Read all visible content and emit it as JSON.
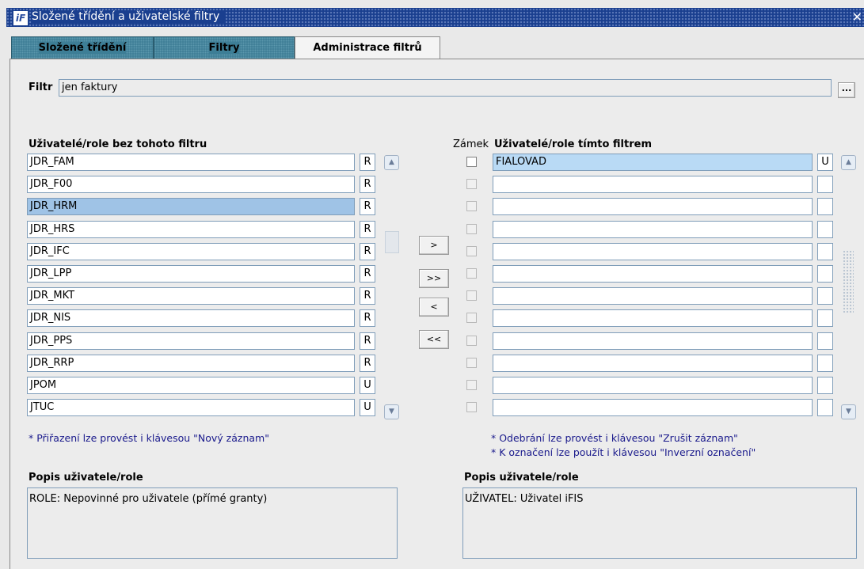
{
  "window": {
    "title": "Složené třídění a uživatelské filtry",
    "icon": "oracle-forms-icon"
  },
  "tabs": [
    {
      "label": "Složené třídění",
      "active": false
    },
    {
      "label": "Filtry",
      "active": false
    },
    {
      "label": "Administrace filtrů",
      "active": true
    }
  ],
  "filter": {
    "label": "Filtr",
    "value": "jen faktury",
    "lookup_label": "..."
  },
  "left_list": {
    "header": "Uživatelé/role bez tohoto filtru",
    "rows": [
      {
        "name": "JDR_FAM",
        "type": "R"
      },
      {
        "name": "JDR_F00",
        "type": "R"
      },
      {
        "name": "JDR_HRM",
        "type": "R"
      },
      {
        "name": "JDR_HRS",
        "type": "R"
      },
      {
        "name": "JDR_IFC",
        "type": "R"
      },
      {
        "name": "JDR_LPP",
        "type": "R"
      },
      {
        "name": "JDR_MKT",
        "type": "R"
      },
      {
        "name": "JDR_NIS",
        "type": "R"
      },
      {
        "name": "JDR_PPS",
        "type": "R"
      },
      {
        "name": "JDR_RRP",
        "type": "R"
      },
      {
        "name": "JPOM",
        "type": "U"
      },
      {
        "name": "JTUC",
        "type": "U"
      }
    ],
    "selected_index": 2,
    "note": "* Přiřazení lze provést i klávesou \"Nový záznam\""
  },
  "transfer_buttons": [
    ">",
    ">>",
    "<",
    "<<"
  ],
  "right_list": {
    "lock_header": "Zámek",
    "header": "Uživatelé/role tímto filtrem",
    "rows": [
      {
        "name": "FIALOVAD",
        "type": "U"
      },
      {
        "name": "",
        "type": ""
      },
      {
        "name": "",
        "type": ""
      },
      {
        "name": "",
        "type": ""
      },
      {
        "name": "",
        "type": ""
      },
      {
        "name": "",
        "type": ""
      },
      {
        "name": "",
        "type": ""
      },
      {
        "name": "",
        "type": ""
      },
      {
        "name": "",
        "type": ""
      },
      {
        "name": "",
        "type": ""
      },
      {
        "name": "",
        "type": ""
      },
      {
        "name": "",
        "type": ""
      }
    ],
    "notes": [
      "* Odebrání lze provést i klávesou \"Zrušit záznam\"",
      "* K označení lze použít i klávesou \"Inverzní označení\""
    ]
  },
  "left_desc": {
    "label": "Popis uživatele/role",
    "value": "ROLE: Nepovinné pro uživatele (přímé granty)"
  },
  "right_desc": {
    "label": "Popis uživatele/role",
    "value": "UŽIVATEL: Uživatel iFIS"
  },
  "colors": {
    "titlebar": "#1a3f8f",
    "tab_inactive": "#3a7a92",
    "selected_row": "#9fc3e6",
    "note_text": "#1a1a8c"
  }
}
